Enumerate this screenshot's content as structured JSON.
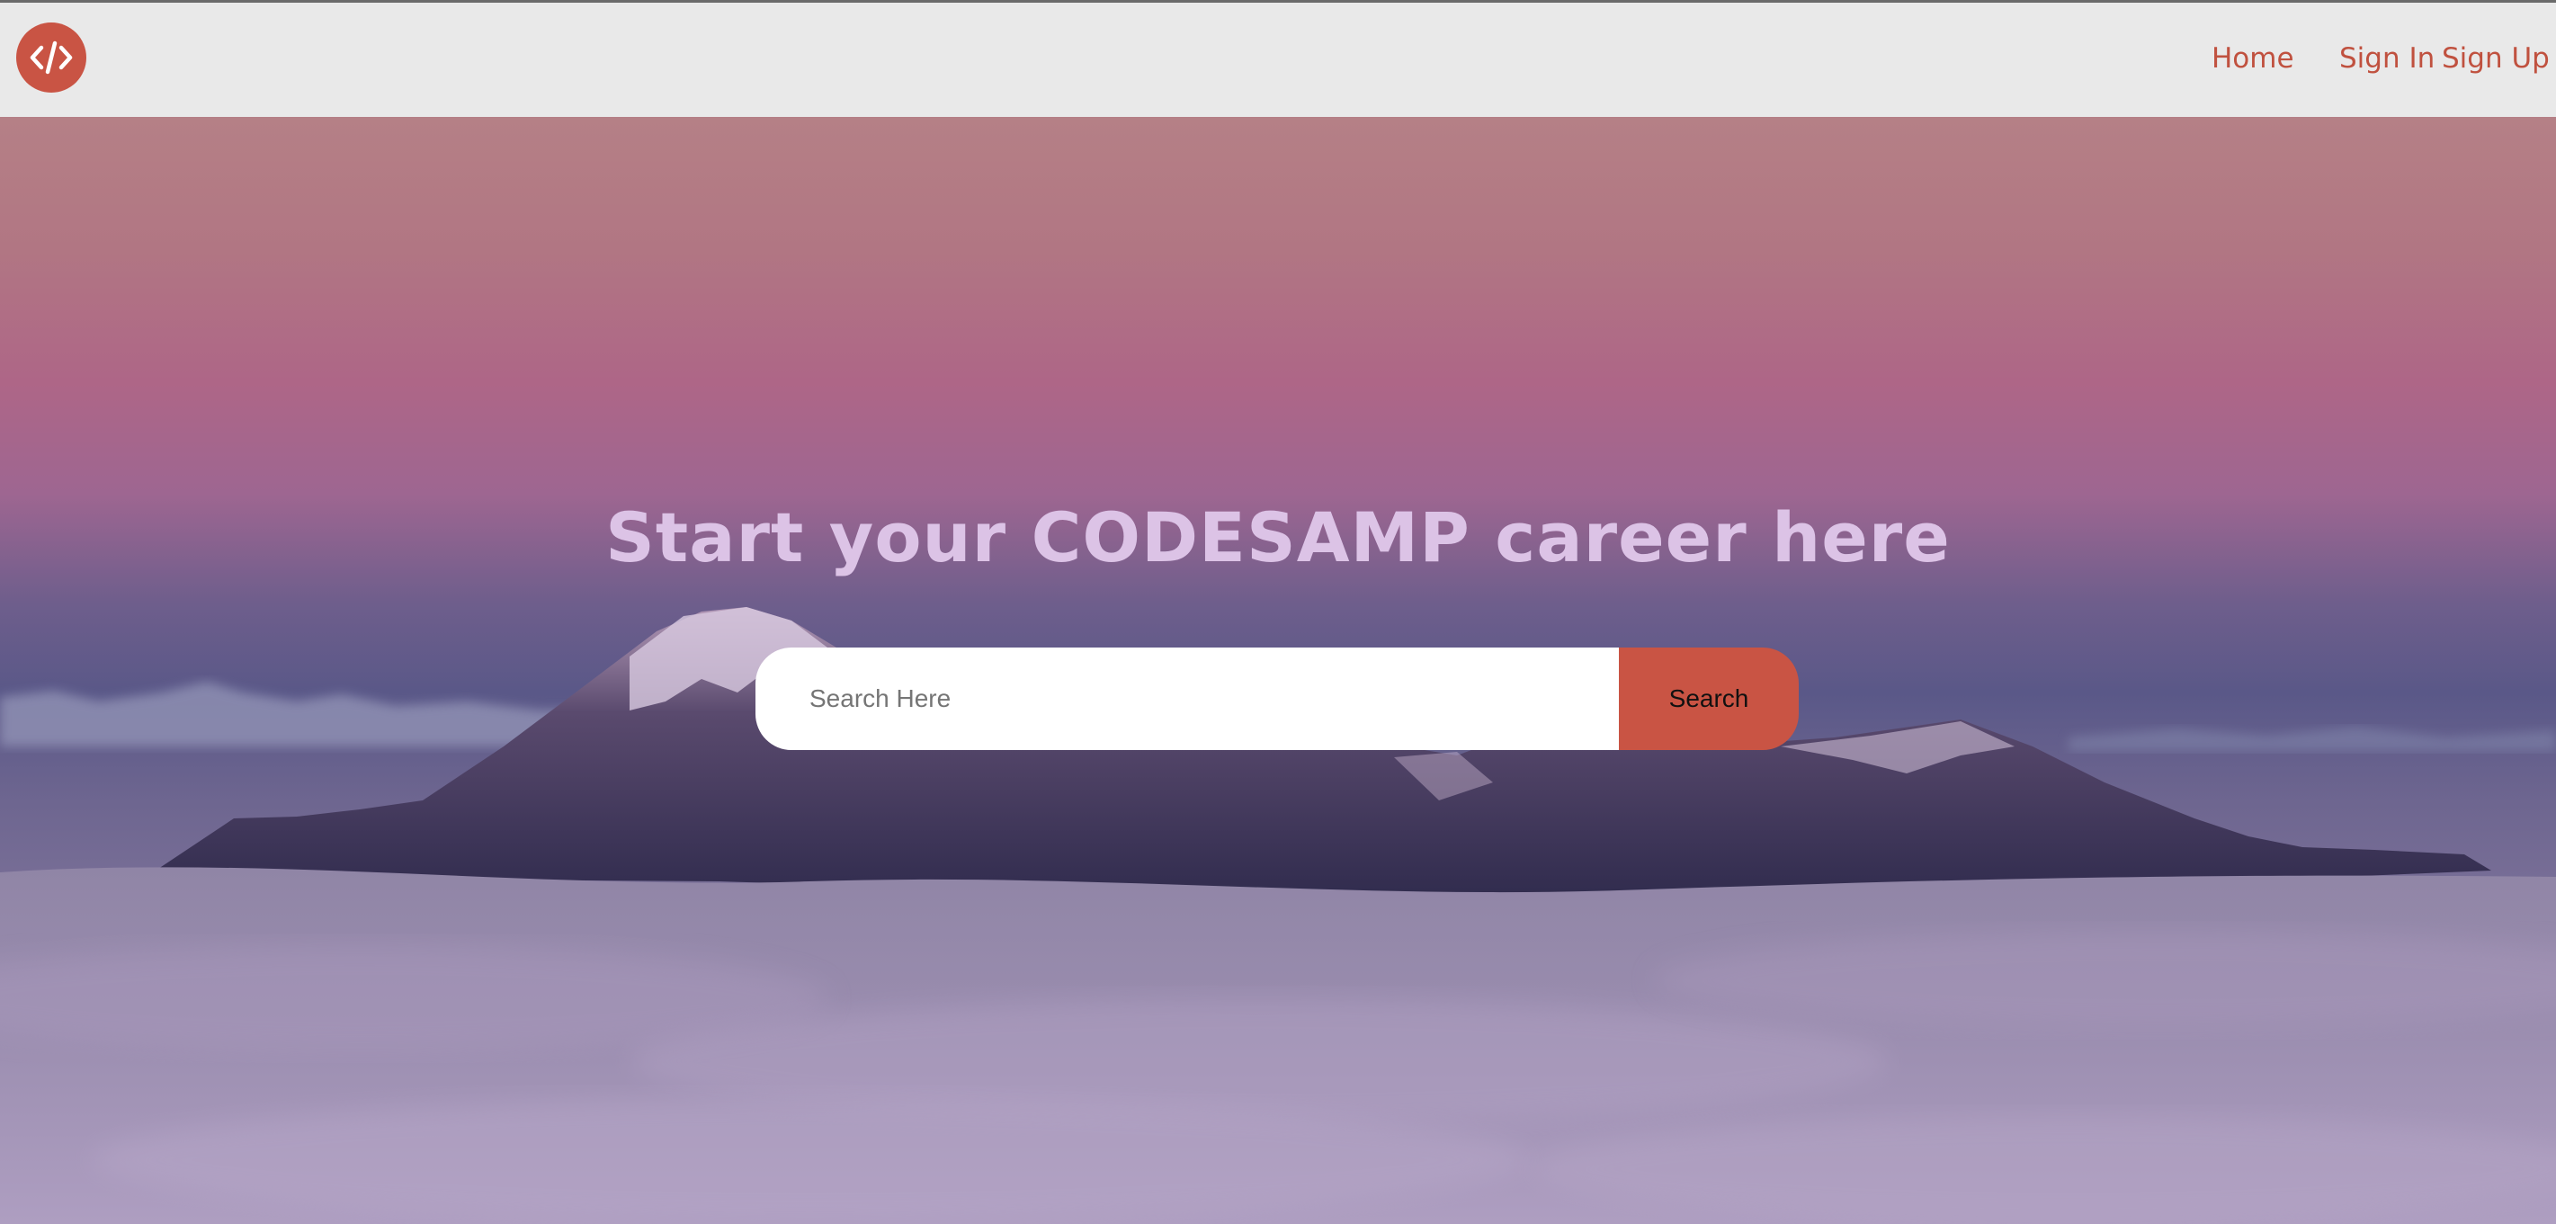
{
  "navbar": {
    "logo_icon": "code-brackets-icon",
    "links": {
      "home": "Home",
      "sign_in": "Sign In",
      "sign_up": "Sign Up"
    }
  },
  "hero": {
    "headline": "Start your CODESAMP career here",
    "search": {
      "placeholder": "Search Here",
      "value": "",
      "button_label": "Search"
    }
  },
  "colors": {
    "accent": "#c95444",
    "navbar_bg": "#e9e9e9",
    "headline": "#dcc3e6"
  }
}
